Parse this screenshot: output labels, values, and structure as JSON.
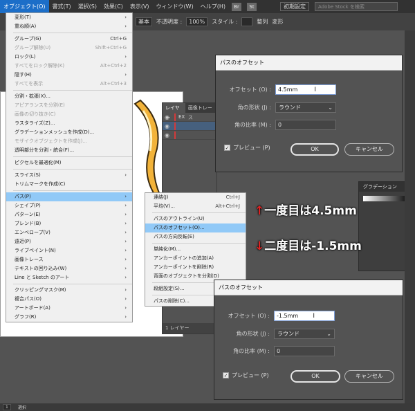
{
  "menubar": {
    "items": [
      "オブジェクト(O)",
      "書式(T)",
      "選択(S)",
      "効果(C)",
      "表示(V)",
      "ウィンドウ(W)",
      "ヘルプ(H)"
    ],
    "badges": [
      "Br",
      "St"
    ],
    "preset": "初期設定",
    "stock_placeholder": "Adobe Stock を検索"
  },
  "controlbar": {
    "stroke_style": "基本",
    "opacity_label": "不透明度 :",
    "opacity_value": "100%",
    "style_label": "スタイル :",
    "align_label": "整列",
    "transform_label": "変形"
  },
  "object_menu": {
    "items": [
      {
        "label": "変形(T)",
        "shortcut": "",
        "sub": true,
        "disabled": false
      },
      {
        "label": "重ね順(A)",
        "shortcut": "",
        "sub": true,
        "disabled": false
      },
      {
        "sep": true
      },
      {
        "label": "グループ(G)",
        "shortcut": "Ctrl+G",
        "sub": false,
        "disabled": false
      },
      {
        "label": "グループ解除(U)",
        "shortcut": "Shift+Ctrl+G",
        "sub": false,
        "disabled": true
      },
      {
        "label": "ロック(L)",
        "shortcut": "",
        "sub": true,
        "disabled": false
      },
      {
        "label": "すべてをロック解除(K)",
        "shortcut": "Alt+Ctrl+2",
        "sub": false,
        "disabled": true
      },
      {
        "label": "隠す(H)",
        "shortcut": "",
        "sub": true,
        "disabled": false
      },
      {
        "label": "すべてを表示",
        "shortcut": "Alt+Ctrl+3",
        "sub": false,
        "disabled": true
      },
      {
        "sep": true
      },
      {
        "label": "分割・拡張(X)...",
        "shortcut": "",
        "sub": false,
        "disabled": false
      },
      {
        "label": "アピアランスを分割(E)",
        "shortcut": "",
        "sub": false,
        "disabled": true
      },
      {
        "label": "画像の切り抜き(C)",
        "shortcut": "",
        "sub": false,
        "disabled": true
      },
      {
        "label": "ラスタライズ(Z)...",
        "shortcut": "",
        "sub": false,
        "disabled": false
      },
      {
        "label": "グラデーションメッシュを作成(D)...",
        "shortcut": "",
        "sub": false,
        "disabled": false
      },
      {
        "label": "モザイクオブジェクトを作成(J)...",
        "shortcut": "",
        "sub": false,
        "disabled": true
      },
      {
        "label": "透明部分を分割・統合(F)...",
        "shortcut": "",
        "sub": false,
        "disabled": false
      },
      {
        "sep": true
      },
      {
        "label": "ピクセルを最適化(M)",
        "shortcut": "",
        "sub": false,
        "disabled": false
      },
      {
        "sep": true
      },
      {
        "label": "スライス(S)",
        "shortcut": "",
        "sub": true,
        "disabled": false
      },
      {
        "label": "トリムマークを作成(C)",
        "shortcut": "",
        "sub": false,
        "disabled": false
      },
      {
        "sep": true
      },
      {
        "label": "パス(P)",
        "shortcut": "",
        "sub": true,
        "disabled": false,
        "highlight": true
      },
      {
        "label": "シェイプ(P)",
        "shortcut": "",
        "sub": true,
        "disabled": false
      },
      {
        "label": "パターン(E)",
        "shortcut": "",
        "sub": true,
        "disabled": false
      },
      {
        "label": "ブレンド(B)",
        "shortcut": "",
        "sub": true,
        "disabled": false
      },
      {
        "label": "エンベロープ(V)",
        "shortcut": "",
        "sub": true,
        "disabled": false
      },
      {
        "label": "遠近(P)",
        "shortcut": "",
        "sub": true,
        "disabled": false
      },
      {
        "label": "ライブペイント(N)",
        "shortcut": "",
        "sub": true,
        "disabled": false
      },
      {
        "label": "画像トレース",
        "shortcut": "",
        "sub": true,
        "disabled": false
      },
      {
        "label": "テキストの回り込み(W)",
        "shortcut": "",
        "sub": true,
        "disabled": false
      },
      {
        "label": "Line と Sketch のアート",
        "shortcut": "",
        "sub": true,
        "disabled": false
      },
      {
        "sep": true
      },
      {
        "label": "クリッピングマスク(M)",
        "shortcut": "",
        "sub": true,
        "disabled": false
      },
      {
        "label": "複合パス(O)",
        "shortcut": "",
        "sub": true,
        "disabled": false
      },
      {
        "label": "アートボード(A)",
        "shortcut": "",
        "sub": true,
        "disabled": false
      },
      {
        "label": "グラフ(R)",
        "shortcut": "",
        "sub": true,
        "disabled": false
      }
    ]
  },
  "path_menu": {
    "items": [
      {
        "label": "連結(J)",
        "shortcut": "Ctrl+J"
      },
      {
        "label": "平均(V)...",
        "shortcut": "Alt+Ctrl+J"
      },
      {
        "sep": true
      },
      {
        "label": "パスのアウトライン(U)",
        "shortcut": ""
      },
      {
        "label": "パスのオフセット(O)...",
        "shortcut": "",
        "highlight": true
      },
      {
        "label": "パスの方向反転(E)",
        "shortcut": ""
      },
      {
        "sep": true
      },
      {
        "label": "単純化(M)...",
        "shortcut": ""
      },
      {
        "label": "アンカーポイントの追加(A)",
        "shortcut": ""
      },
      {
        "label": "アンカーポイントを削除(R)",
        "shortcut": ""
      },
      {
        "label": "背面のオブジェクトを分割(D)",
        "shortcut": ""
      },
      {
        "sep": true
      },
      {
        "label": "段組設定(S)...",
        "shortcut": ""
      },
      {
        "sep": true
      },
      {
        "label": "パスの削除(C)...",
        "shortcut": ""
      }
    ]
  },
  "layers": {
    "tabs": [
      "レイヤー",
      "画像トレース"
    ],
    "rows": [
      "EX",
      ""
    ],
    "footer": "1 レイヤー"
  },
  "gradient_panel": {
    "tab": "グラデーション"
  },
  "dialog1": {
    "title": "パスのオフセット",
    "offset_label": "オフセット (O) :",
    "offset_value": "4.5mm",
    "join_label": "角の形状 (J) :",
    "join_value": "ラウンド",
    "miter_label": "角の比率 (M) :",
    "miter_value": "0",
    "preview_label": "プレビュー (P)",
    "ok": "OK",
    "cancel": "キャンセル"
  },
  "dialog2": {
    "title": "パスのオフセット",
    "offset_label": "オフセット (O) :",
    "offset_value": "-1.5mm",
    "join_label": "角の形状 (J) :",
    "join_value": "ラウンド",
    "miter_label": "角の比率 (M) :",
    "miter_value": "0",
    "preview_label": "プレビュー (P)",
    "ok": "OK",
    "cancel": "キャンセル"
  },
  "annotations": {
    "first": "一度目は4.5mm",
    "second": "二度目は-1.5mm"
  },
  "statusbar": {
    "page": "1",
    "mode": "選択"
  },
  "colors": {
    "highlight": "#91c9f7",
    "menu_active": "#1c6ec8",
    "arrow_red": "#e02222"
  }
}
